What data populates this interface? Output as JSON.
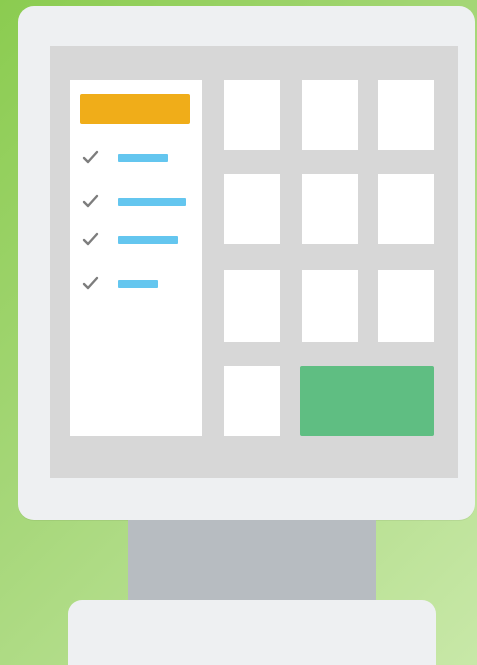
{
  "title": "",
  "checklist": {
    "items": [
      {
        "checked": true,
        "line_color": "#64c6ef"
      },
      {
        "checked": true,
        "line_color": "#64c6ef"
      },
      {
        "checked": true,
        "line_color": "#64c6ef"
      },
      {
        "checked": true,
        "line_color": "#64c6ef"
      }
    ]
  },
  "colors": {
    "background": "#a6d779",
    "monitor": "#eef0f2",
    "screen": "#d7d7d7",
    "panel": "#ffffff",
    "accent_orange": "#f0ad19",
    "accent_blue": "#64c6ef",
    "accent_green": "#5fbe82",
    "stand": "#b7bcc1"
  }
}
